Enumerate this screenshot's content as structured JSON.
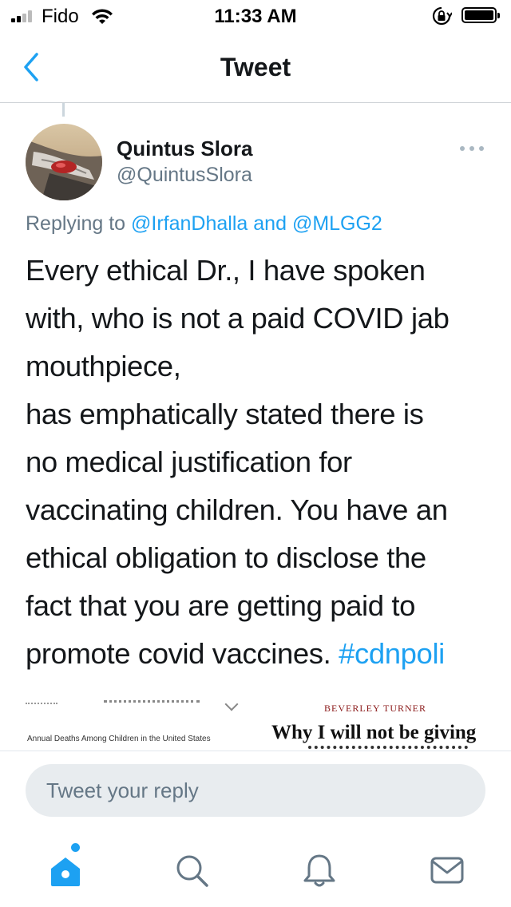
{
  "status_bar": {
    "carrier": "Fido",
    "time": "11:33 AM",
    "icons": [
      "signal-icon",
      "wifi-icon",
      "orientation-lock-icon",
      "battery-icon"
    ]
  },
  "nav": {
    "title": "Tweet",
    "back_icon": "chevron-left-icon"
  },
  "tweet": {
    "author_name": "Quintus Slora",
    "author_handle": "@QuintusSlora",
    "replying_prefix": "Replying to",
    "reply_mention_1": "@IrfanDhalla",
    "reply_conjunction": "and",
    "reply_mention_2": "@MLGG2",
    "text_lines": [
      "Every ethical Dr., I have spoken",
      "with, who is not a paid COVID jab",
      "mouthpiece,",
      "has emphatically stated there is",
      "no medical justification for",
      "vaccinating children. You have an",
      "ethical obligation to disclose the",
      "fact that you are getting paid to",
      "promote covid vaccines."
    ],
    "hashtag": "#cdnpoli",
    "more_icon": "more-dots-icon"
  },
  "media": {
    "left_caption": "Annual Deaths Among Children in the United States",
    "right_byline": "BEVERLEY TURNER",
    "right_headline": "Why I will not be giving"
  },
  "composer": {
    "placeholder": "Tweet your reply"
  },
  "tabbar": {
    "items": [
      "home-icon",
      "search-icon",
      "notifications-icon",
      "messages-icon"
    ],
    "active": "home-icon"
  },
  "colors": {
    "accent": "#1da1f2",
    "secondary_text": "#657786",
    "primary_text": "#14171a",
    "input_bg": "#e8ecef"
  }
}
